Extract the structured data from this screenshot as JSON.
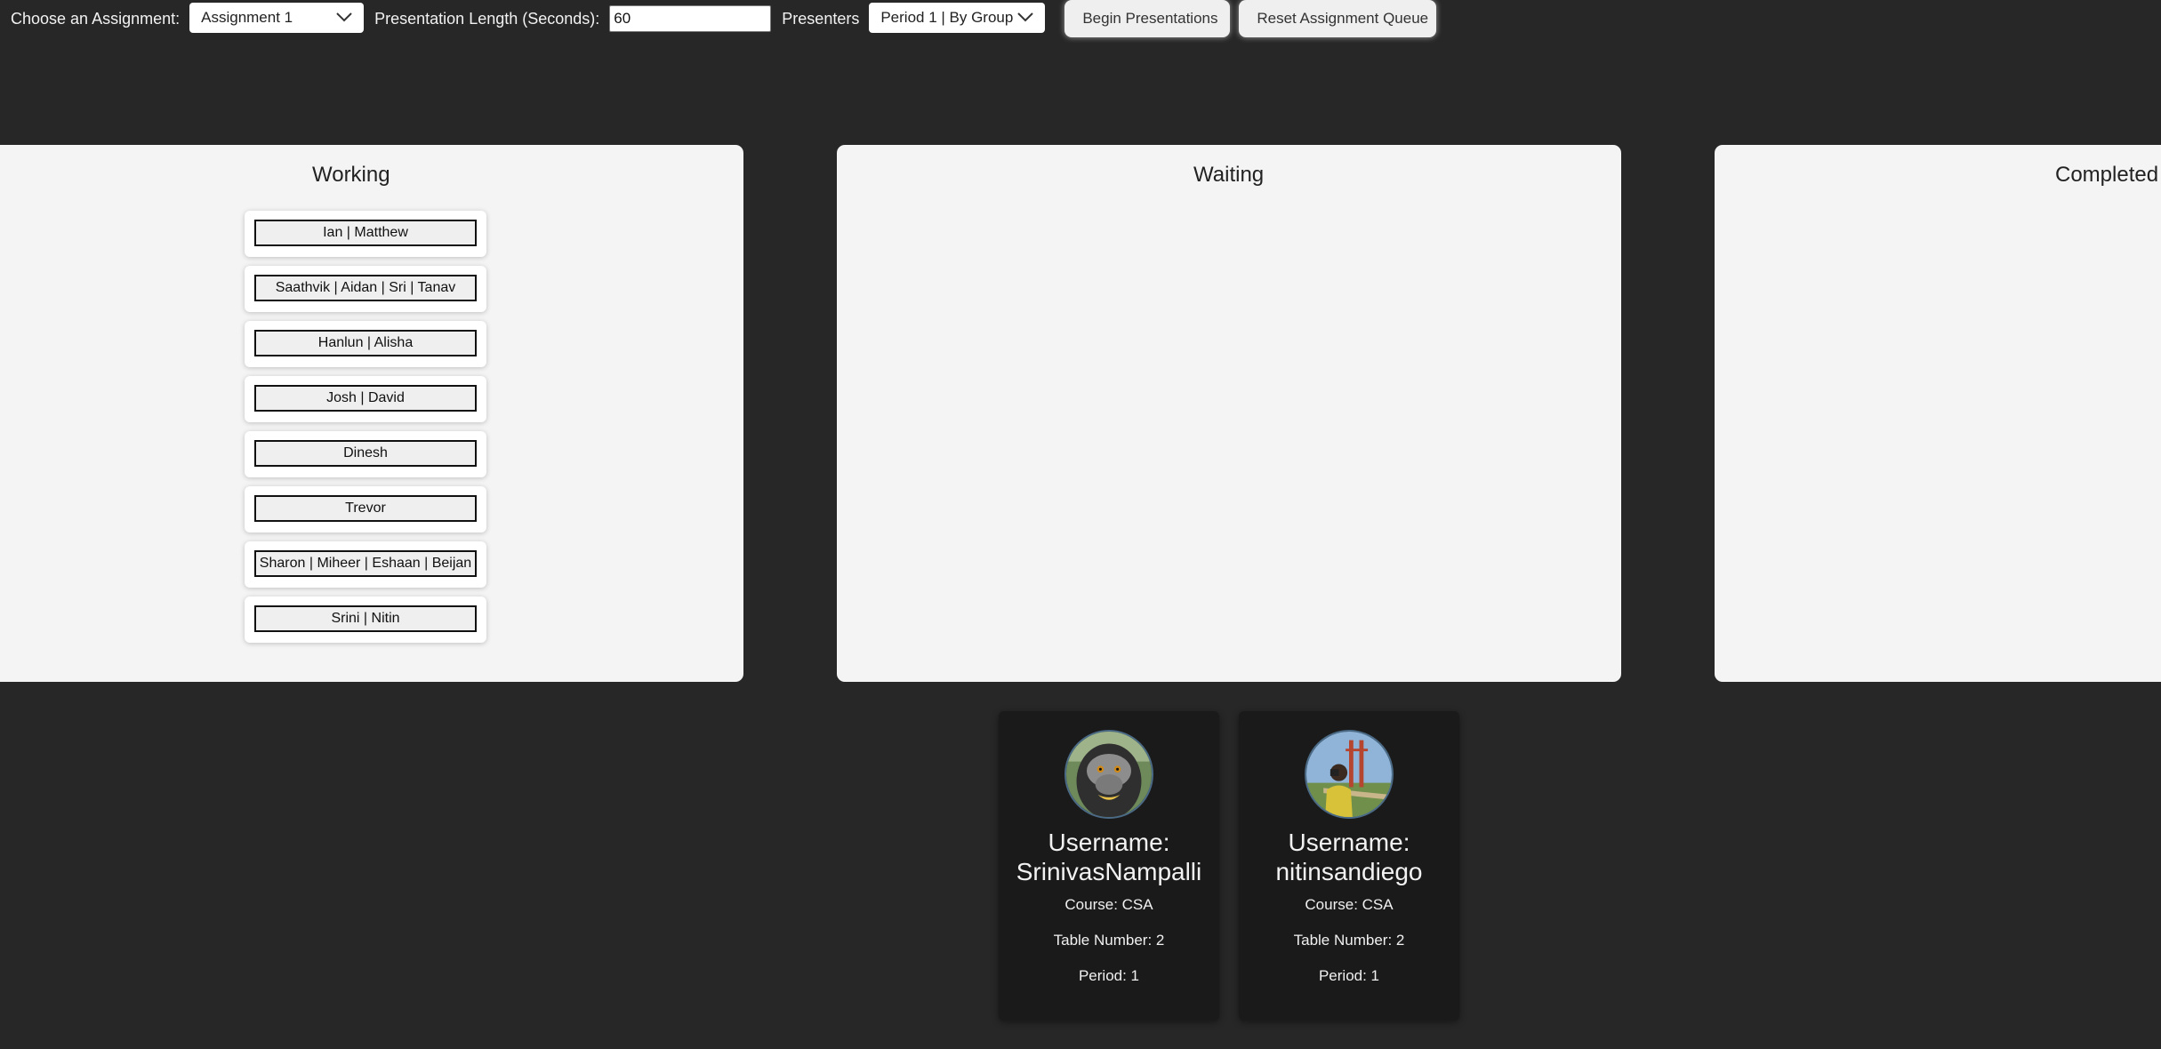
{
  "toolbar": {
    "assignment_label": "Choose an Assignment:",
    "assignment_value": "Assignment 1",
    "length_label": "Presentation Length (Seconds):",
    "length_value": "60",
    "presenters_label": "Presenters",
    "presenters_value": "Period 1 | By Group",
    "begin_label": "Begin Presentations",
    "reset_label": "Reset Assignment Queue"
  },
  "columns": {
    "working": {
      "title": "Working",
      "groups": [
        "Ian | Matthew",
        "Saathvik | Aidan | Sri | Tanav",
        "Hanlun | Alisha",
        "Josh | David",
        "Dinesh",
        "Trevor",
        "Sharon | Miheer | Eshaan | Beijan",
        "Srini | Nitin"
      ]
    },
    "waiting": {
      "title": "Waiting"
    },
    "completed": {
      "title": "Completed"
    }
  },
  "profiles": [
    {
      "username_label": "Username:",
      "username": "SrinivasNampalli",
      "course": "Course: CSA",
      "table": "Table Number: 2",
      "period": "Period: 1"
    },
    {
      "username_label": "Username:",
      "username": "nitinsandiego",
      "course": "Course: CSA",
      "table": "Table Number: 2",
      "period": "Period: 1"
    }
  ],
  "icons": {
    "dropdown": "chevron-down-icon"
  }
}
